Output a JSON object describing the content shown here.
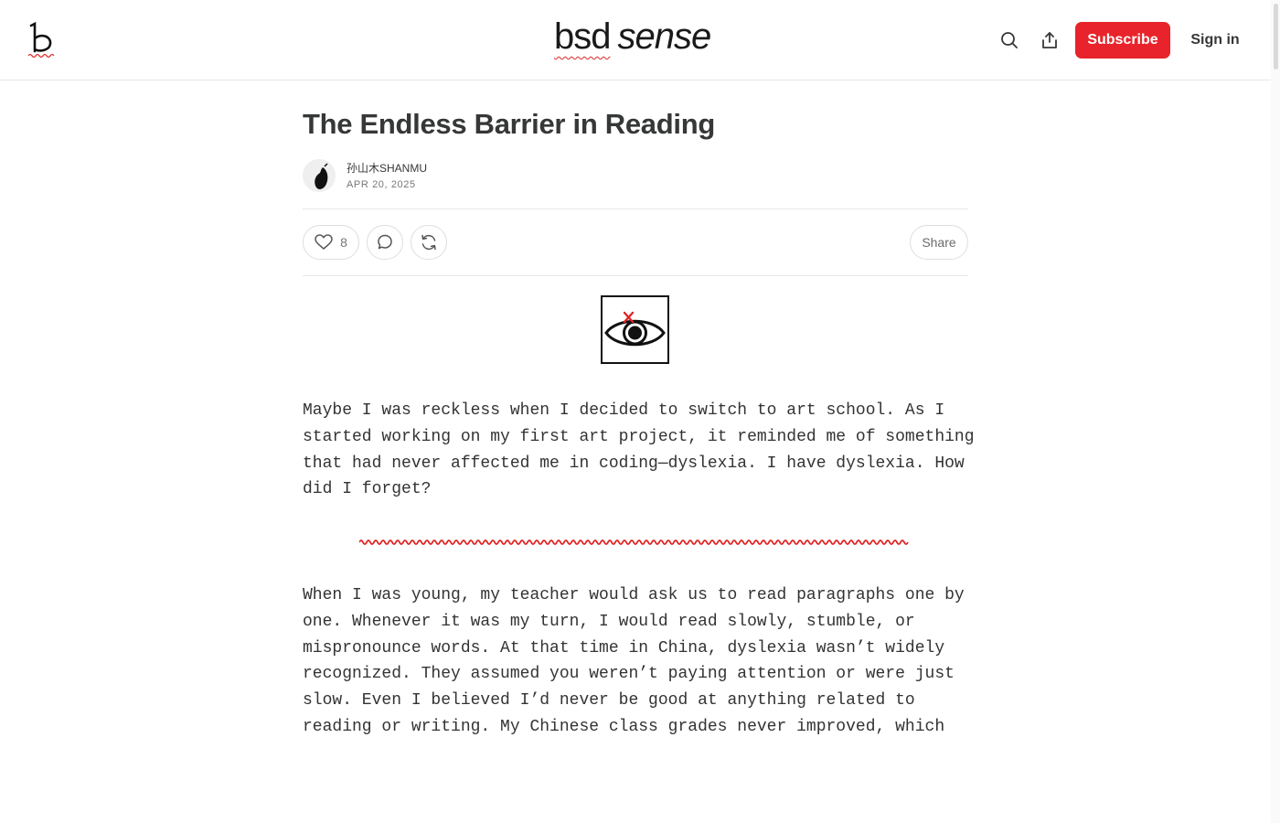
{
  "header": {
    "brand_part1": "bsd",
    "brand_part2": "sense",
    "subscribe_label": "Subscribe",
    "signin_label": "Sign in"
  },
  "post": {
    "title": "The Endless Barrier in Reading",
    "author": "孙山木SHANMU",
    "date": "APR 20, 2025",
    "like_count": "8",
    "share_label": "Share",
    "paragraphs": [
      "Maybe I was reckless when I decided to switch to art school. As I started working on my first art project, it reminded me of something that had never affected me in coding—dyslexia. I have dyslexia. How did I forget?",
      "When I was young, my teacher would ask us to read paragraphs one by one. Whenever it was my turn, I would read slowly, stumble, or mispronounce words. At that time in China, dyslexia wasn’t widely recognized. They assumed you weren’t paying attention or were just slow. Even I believed I’d never be good at anything related to reading or writing. My Chinese class grades never improved, which"
    ]
  },
  "colors": {
    "accent": "#e8232b",
    "text": "#363737",
    "muted": "#777777"
  },
  "icons": {
    "search": "search-icon",
    "share": "share-icon",
    "like": "heart-icon",
    "comment": "comment-icon",
    "restack": "restack-icon"
  }
}
